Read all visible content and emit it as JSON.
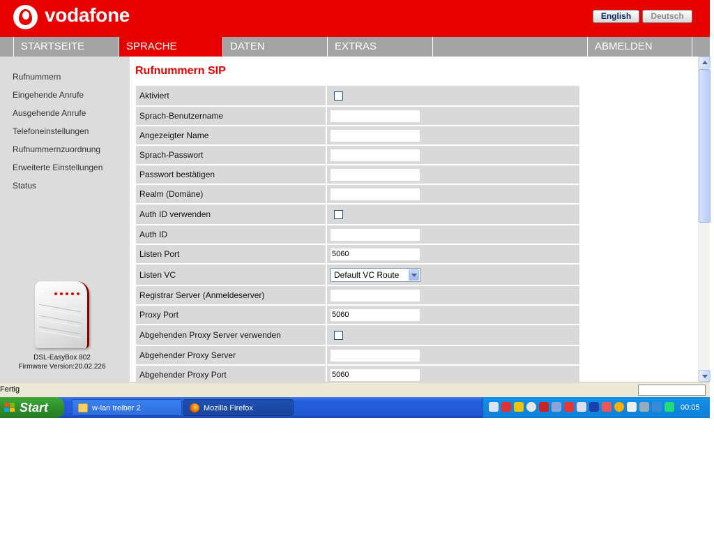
{
  "header": {
    "brand": "vodafone",
    "lang_english": "English",
    "lang_deutsch": "Deutsch"
  },
  "nav": {
    "items": [
      "STARTSEITE",
      "SPRACHE",
      "DATEN",
      "EXTRAS",
      "ABMELDEN"
    ],
    "active": "SPRACHE"
  },
  "sidebar": {
    "links": [
      "Rufnummern",
      "Eingehende Anrufe",
      "Ausgehende Anrufe",
      "Telefoneinstellungen",
      "Rufnummernzuordnung",
      "Erweiterte Einstellungen",
      "Status"
    ],
    "device_name": "DSL-EasyBox 802",
    "firmware": "Firmware Version:20.02.226"
  },
  "main": {
    "title": "Rufnummern SIP",
    "rows": [
      {
        "label": "Aktiviert",
        "type": "checkbox",
        "value": ""
      },
      {
        "label": "Sprach-Benutzername",
        "type": "text",
        "value": ""
      },
      {
        "label": "Angezeigter Name",
        "type": "text",
        "value": ""
      },
      {
        "label": "Sprach-Passwort",
        "type": "text",
        "value": ""
      },
      {
        "label": "Passwort bestätigen",
        "type": "text",
        "value": ""
      },
      {
        "label": "Realm (Domäne)",
        "type": "text",
        "value": ""
      },
      {
        "label": "Auth ID verwenden",
        "type": "checkbox",
        "value": ""
      },
      {
        "label": "Auth ID",
        "type": "text",
        "value": ""
      },
      {
        "label": "Listen Port",
        "type": "text",
        "value": "5060"
      },
      {
        "label": "Listen VC",
        "type": "select",
        "value": "Default VC Route"
      },
      {
        "label": "Registrar Server (Anmeldeserver)",
        "type": "text",
        "value": ""
      },
      {
        "label": "Proxy Port",
        "type": "text",
        "value": "5060"
      },
      {
        "label": "Abgehenden Proxy Server verwenden",
        "type": "checkbox",
        "value": ""
      },
      {
        "label": "Abgehender Proxy Server",
        "type": "text",
        "value": ""
      },
      {
        "label": "Abgehender Proxy Port",
        "type": "text",
        "value": "5060"
      }
    ]
  },
  "statusbar": {
    "text": "Fertig"
  },
  "taskbar": {
    "start_label": "Start",
    "tasks": [
      "w-lan treiber 2",
      "Mozilla Firefox"
    ],
    "clock": "00:05"
  },
  "colors": {
    "brand_red": "#e60000",
    "nav_gray": "#a3a3a3",
    "row_gray": "#d9d9d9"
  }
}
